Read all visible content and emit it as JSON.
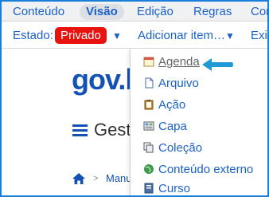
{
  "menubar": {
    "items": [
      "Conteúdo",
      "Visão",
      "Edição",
      "Regras",
      "Con"
    ],
    "active": "Visão"
  },
  "toolbar": {
    "estado_label": "Estado:",
    "status": "Privado",
    "add_label": "Adicionar item…",
    "more_label": "Exi"
  },
  "page": {
    "logo_main": "gov.b",
    "title": "Gest",
    "breadcrumb": "Manu"
  },
  "dropdown": {
    "items": [
      {
        "label": "Agenda",
        "icon": "calendar-icon"
      },
      {
        "label": "Arquivo",
        "icon": "file-icon"
      },
      {
        "label": "Ação",
        "icon": "clipboard-icon"
      },
      {
        "label": "Capa",
        "icon": "grid-icon"
      },
      {
        "label": "Coleção",
        "icon": "copy-icon"
      },
      {
        "label": "Conteúdo externo",
        "icon": "globe-icon"
      },
      {
        "label": "Curso",
        "icon": "document-icon"
      }
    ]
  },
  "colors": {
    "accent": "#1a62c8",
    "status_red": "#e8120f",
    "frame_blue": "#1a7fd8",
    "arrow_blue": "#1f9ad6"
  }
}
